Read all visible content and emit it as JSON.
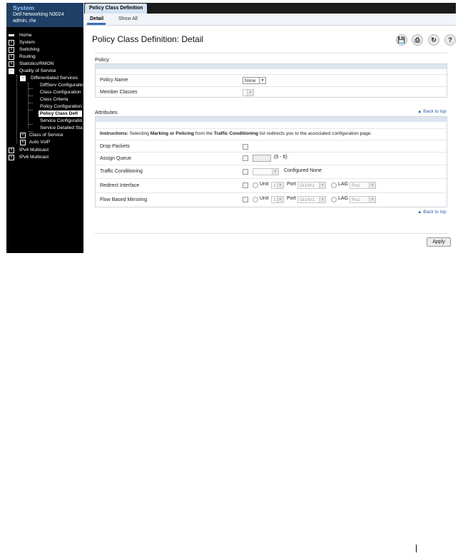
{
  "sidebar": {
    "system_title": "System",
    "model": "Dell Networking N3024",
    "user": "admin, r/w",
    "items": [
      {
        "label": "Home",
        "icon": "home-icon"
      },
      {
        "label": "System",
        "icon": "plus-icon"
      },
      {
        "label": "Switching",
        "icon": "plus-icon"
      },
      {
        "label": "Routing",
        "icon": "plus-icon"
      },
      {
        "label": "Statistics/RMON",
        "icon": "plus-icon"
      },
      {
        "label": "Quality of Service",
        "icon": "minus-icon"
      },
      {
        "label": "Differentiated Services",
        "icon": "minus-icon"
      },
      {
        "label": "DiffServ Configuratio"
      },
      {
        "label": "Class Configuration"
      },
      {
        "label": "Class Criteria"
      },
      {
        "label": "Policy Configuration"
      },
      {
        "label": "Policy Class Defi",
        "selected": true
      },
      {
        "label": "Service Configuratio"
      },
      {
        "label": "Service Detailed Sta"
      },
      {
        "label": "Class of Service",
        "icon": "plus-icon"
      },
      {
        "label": "Auto VoIP",
        "icon": "plus-icon"
      },
      {
        "label": "IPv4 Multicast",
        "icon": "plus-icon"
      },
      {
        "label": "IPv6 Multicast",
        "icon": "plus-icon"
      }
    ]
  },
  "tabs": {
    "active": "Policy Class Definition",
    "sub": [
      "Detail",
      "Show All"
    ]
  },
  "page": {
    "title": "Policy Class Definition: Detail",
    "toolbar_icons": [
      "save-icon",
      "print-icon",
      "refresh-icon",
      "help-icon"
    ],
    "toolbar_glyphs": {
      "save": "💾",
      "print": "⎙",
      "refresh": "↻",
      "help": "?"
    }
  },
  "policy": {
    "section": "Policy",
    "policy_name_label": "Policy Name",
    "policy_name_value": "None",
    "member_classes_label": "Member Classes"
  },
  "attributes": {
    "section": "Attributes",
    "back_to_top": "Back to top",
    "instructions_prefix": "Instructions:",
    "instructions_1": " Selecting ",
    "instructions_marking": "Marking or Policing",
    "instructions_2": " from the ",
    "instructions_tc": "Traffic Conditioning",
    "instructions_3": " list redirects you to the associated configuration page.",
    "drop_packets": "Drop Packets",
    "assign_queue": "Assign Queue",
    "assign_queue_range": "(0 - 6)",
    "traffic_conditioning": "Traffic Conditioning",
    "configured_none": "Configured None",
    "redirect_interface": "Redirect Interface",
    "flow_based_mirroring": "Flow Based Mirroring",
    "unit_label": "Unit",
    "unit_value": "1",
    "port_label": "Port",
    "port_value": "Gi1/0/1",
    "lag_label": "LAG",
    "lag_value": "Po1"
  },
  "footer": {
    "back_to_top": "Back to top",
    "apply_label": "Apply"
  }
}
